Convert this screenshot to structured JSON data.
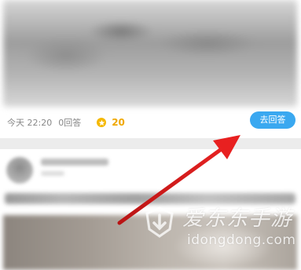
{
  "post": {
    "time": "今天 22:20",
    "answers": "0回答",
    "coins": "20",
    "answer_button": "去回答"
  },
  "watermark": {
    "title": "爱东东手游",
    "domain": "idongdong.com"
  },
  "icons": {
    "coin": "star-coin-icon",
    "watermark_logo": "download-shield-logo"
  },
  "colors": {
    "answer_button": "#3aa8f0",
    "coins": "#f0a800",
    "annotation_arrow": "#e02020"
  }
}
